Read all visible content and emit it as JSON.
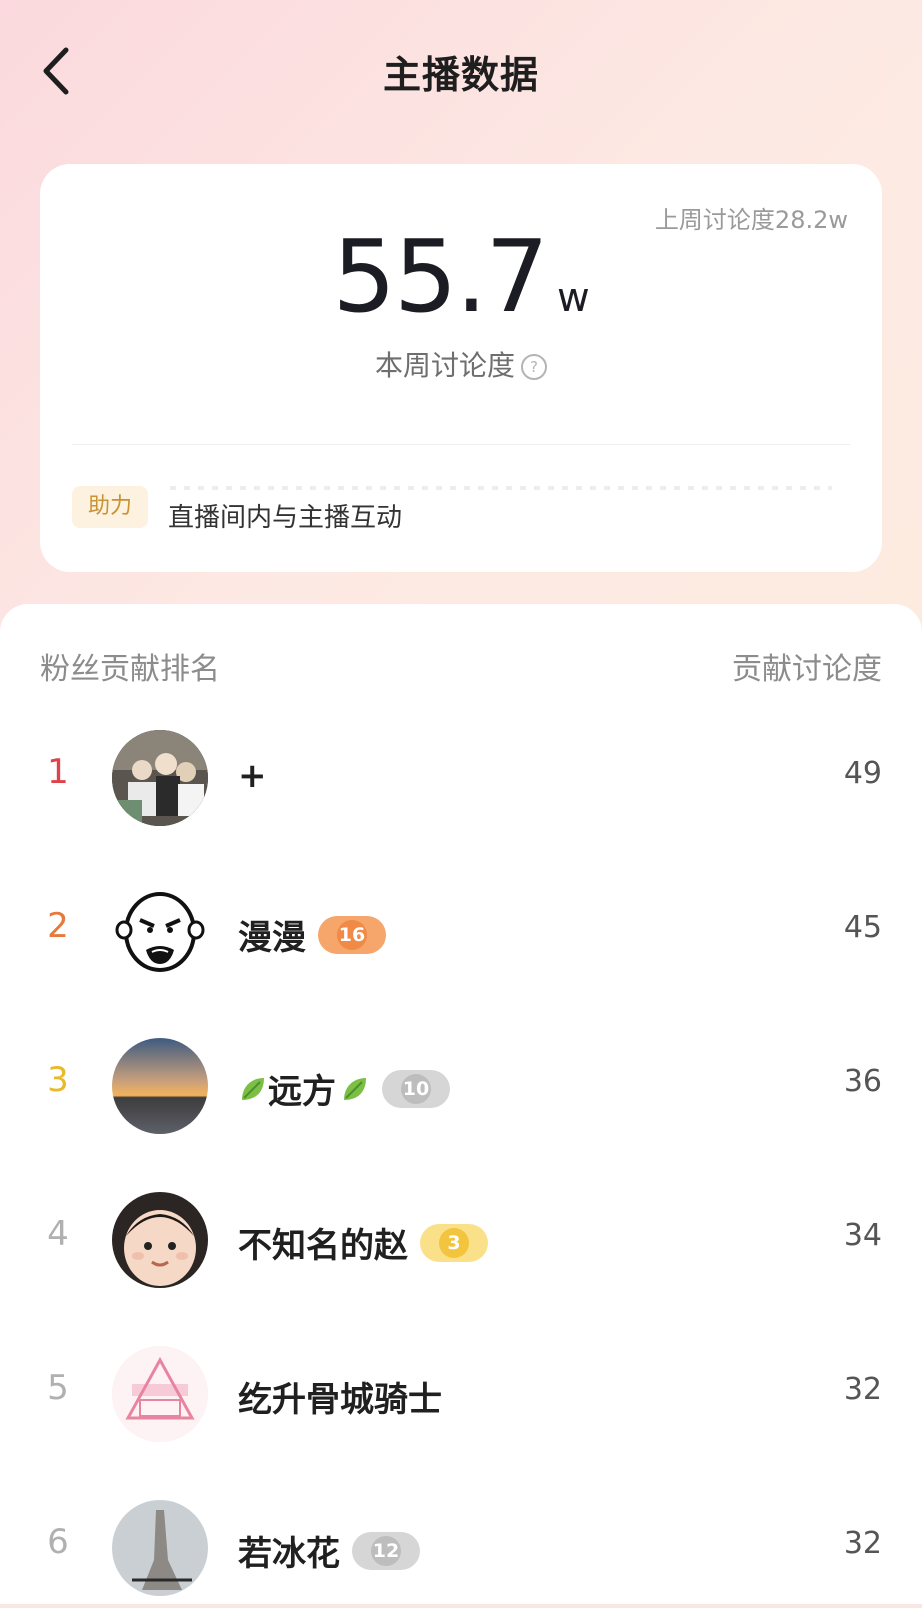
{
  "header": {
    "title": "主播数据"
  },
  "stats": {
    "last_week": "上周讨论度28.2w",
    "this_week_value": "55.7",
    "this_week_unit": "w",
    "this_week_label": "本周讨论度",
    "help_glyph": "?",
    "boost_tag": "助力",
    "boost_desc": "直播间内与主播互动"
  },
  "ranking": {
    "title": "粉丝贡献排名",
    "score_header": "贡献讨论度",
    "rows": [
      {
        "rank": "1",
        "name": "+",
        "badge": "",
        "score": "49",
        "rank_color": "#e0424a"
      },
      {
        "rank": "2",
        "name": "漫漫",
        "badge": "16",
        "score": "45",
        "rank_color": "#e57a3c"
      },
      {
        "rank": "3",
        "name": "远方",
        "badge": "10",
        "score": "36",
        "rank_color": "#e9b92a"
      },
      {
        "rank": "4",
        "name": "不知名的赵",
        "badge": "3",
        "score": "34",
        "rank_color": "#b0b0b0"
      },
      {
        "rank": "5",
        "name": "纥升骨城骑士",
        "badge": "",
        "score": "32",
        "rank_color": "#b0b0b0"
      },
      {
        "rank": "6",
        "name": "若冰花",
        "badge": "12",
        "score": "32",
        "rank_color": "#b0b0b0"
      }
    ]
  },
  "icons": {
    "back": "chevron-left-icon",
    "help": "question-circle-icon",
    "leaf": "leaf-icon"
  }
}
